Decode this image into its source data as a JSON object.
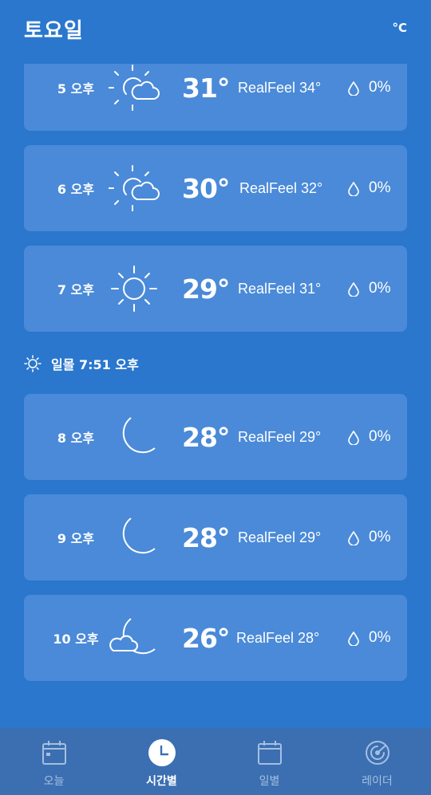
{
  "header": {
    "title": "토요일",
    "unit": "°C"
  },
  "hours": [
    {
      "time": "5 오후",
      "icon": "partly-sunny-icon",
      "temp": "31°",
      "realfeel": "RealFeel 34°",
      "precip": "0%"
    },
    {
      "time": "6 오후",
      "icon": "partly-sunny-icon",
      "temp": "30°",
      "realfeel": "RealFeel 32°",
      "precip": "0%"
    },
    {
      "time": "7 오후",
      "icon": "sun-icon",
      "temp": "29°",
      "realfeel": "RealFeel 31°",
      "precip": "0%"
    },
    {
      "time": "8 오후",
      "icon": "moon-icon",
      "temp": "28°",
      "realfeel": "RealFeel 29°",
      "precip": "0%"
    },
    {
      "time": "9 오후",
      "icon": "moon-icon",
      "temp": "28°",
      "realfeel": "RealFeel 29°",
      "precip": "0%"
    },
    {
      "time": "10 오후",
      "icon": "moon-cloud-icon",
      "temp": "26°",
      "realfeel": "RealFeel 28°",
      "precip": "0%"
    }
  ],
  "sunset": {
    "label": "일몰 7:51 오후",
    "icon": "sun-icon"
  },
  "nav": {
    "items": [
      {
        "label": "오늘",
        "icon": "calendar-icon",
        "active": false
      },
      {
        "label": "시간별",
        "icon": "clock-icon",
        "active": true
      },
      {
        "label": "일별",
        "icon": "calendar-icon",
        "active": false
      },
      {
        "label": "레이더",
        "icon": "radar-icon",
        "active": false
      }
    ]
  },
  "colors": {
    "background": "#2a77cd",
    "card": "#4a8ad8",
    "navbar": "#3b6fb2",
    "nav_inactive": "#a6bfe0"
  }
}
